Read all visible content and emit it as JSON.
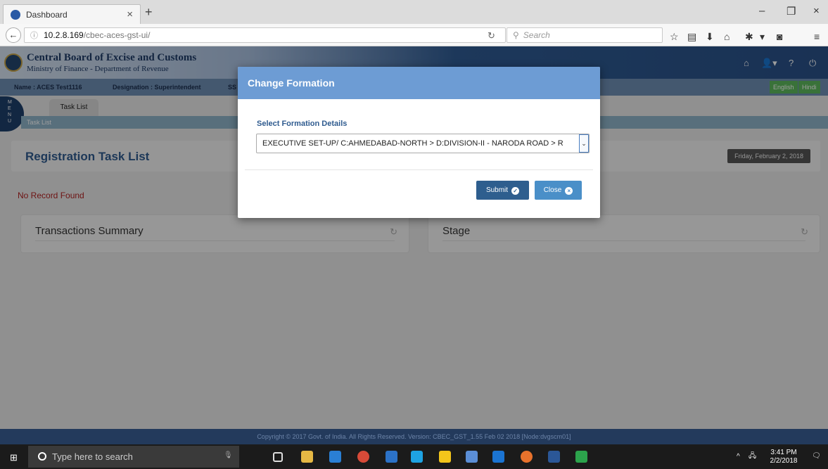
{
  "browser": {
    "tab_title": "Dashboard",
    "tab_close": "×",
    "new_tab": "+",
    "url_host": "10.2.8.169",
    "url_path": "/cbec-aces-gst-ui/",
    "search_placeholder": "Search",
    "window_controls": [
      "–",
      "❐",
      "×"
    ]
  },
  "header": {
    "org_name": "Central Board of Excise and Customs",
    "org_sub": "Ministry of Finance - Department of Revenue"
  },
  "infobar": {
    "name": "Name : ACES Test1116",
    "designation": "Designation : Superintendent",
    "ssc_prefix": "SS",
    "lang_english": "English",
    "lang_hindi": "Hindi"
  },
  "menu": {
    "letters": "M\nE\nN\nU"
  },
  "tabs": {
    "task_list": "Task List"
  },
  "breadcrumb": "Task List",
  "page": {
    "title": "Registration Task List",
    "date": "Friday, February 2, 2018",
    "no_record": "No Record Found"
  },
  "cards": [
    {
      "title": "Transactions Summary"
    },
    {
      "title": "Stage"
    }
  ],
  "modal": {
    "title": "Change Formation",
    "label": "Select Formation Details",
    "selected": "EXECUTIVE SET-UP/ C:AHMEDABAD-NORTH > D:DIVISION-II - NARODA ROAD > R",
    "submit": "Submit",
    "close": "Close"
  },
  "footer": "Copyright © 2017 Govt. of India. All Rights Reserved. Version: CBEC_GST_1.55 Feb 02 2018     [Node:dvgscm01]",
  "taskbar": {
    "search_placeholder": "Type here to search",
    "time": "3:41 PM",
    "date": "2/2/2018"
  },
  "colors": {
    "modal_header": "#6d9cd4",
    "submit": "#2e5e8e",
    "close": "#4a8fc8",
    "title": "#2f5b8f",
    "no_record": "#b22222"
  }
}
